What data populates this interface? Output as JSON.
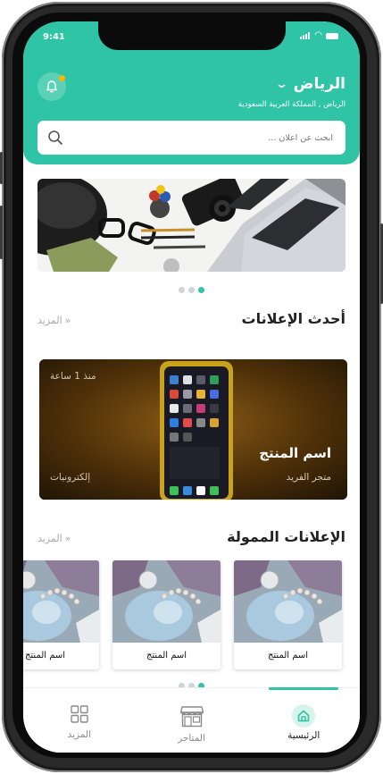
{
  "status_bar": {
    "time": "9:41"
  },
  "header": {
    "city": "الرياض",
    "region": "الرياض , المملكة العربية السعودية"
  },
  "search": {
    "placeholder": "ابحث عن اعلان ..."
  },
  "banner": {
    "slide_count": 3,
    "active_slide": 3
  },
  "latest_ads": {
    "title": "أحدث الإعلانات",
    "more_label": "المزيد",
    "featured": {
      "product_name": "اسم المنتج",
      "store": "متجر الفريد",
      "category": "إلكترونيات",
      "time_ago": "منذ 1 ساعة"
    }
  },
  "sponsored_ads": {
    "title": "الإعلانات الممولة",
    "more_label": "المزيد",
    "items": [
      {
        "name": "اسم المنتج"
      },
      {
        "name": "اسم المنتج"
      },
      {
        "name": "اسم المنتج"
      }
    ]
  },
  "tabbar": {
    "items": [
      {
        "label": "الرئيسية",
        "icon": "home-icon",
        "active": true
      },
      {
        "label": "المتاجر",
        "icon": "store-icon",
        "active": false
      },
      {
        "label": "المزيد",
        "icon": "grid-icon",
        "active": false
      }
    ]
  },
  "colors": {
    "accent": "#2ec4a5",
    "notification": "#ffb400"
  }
}
